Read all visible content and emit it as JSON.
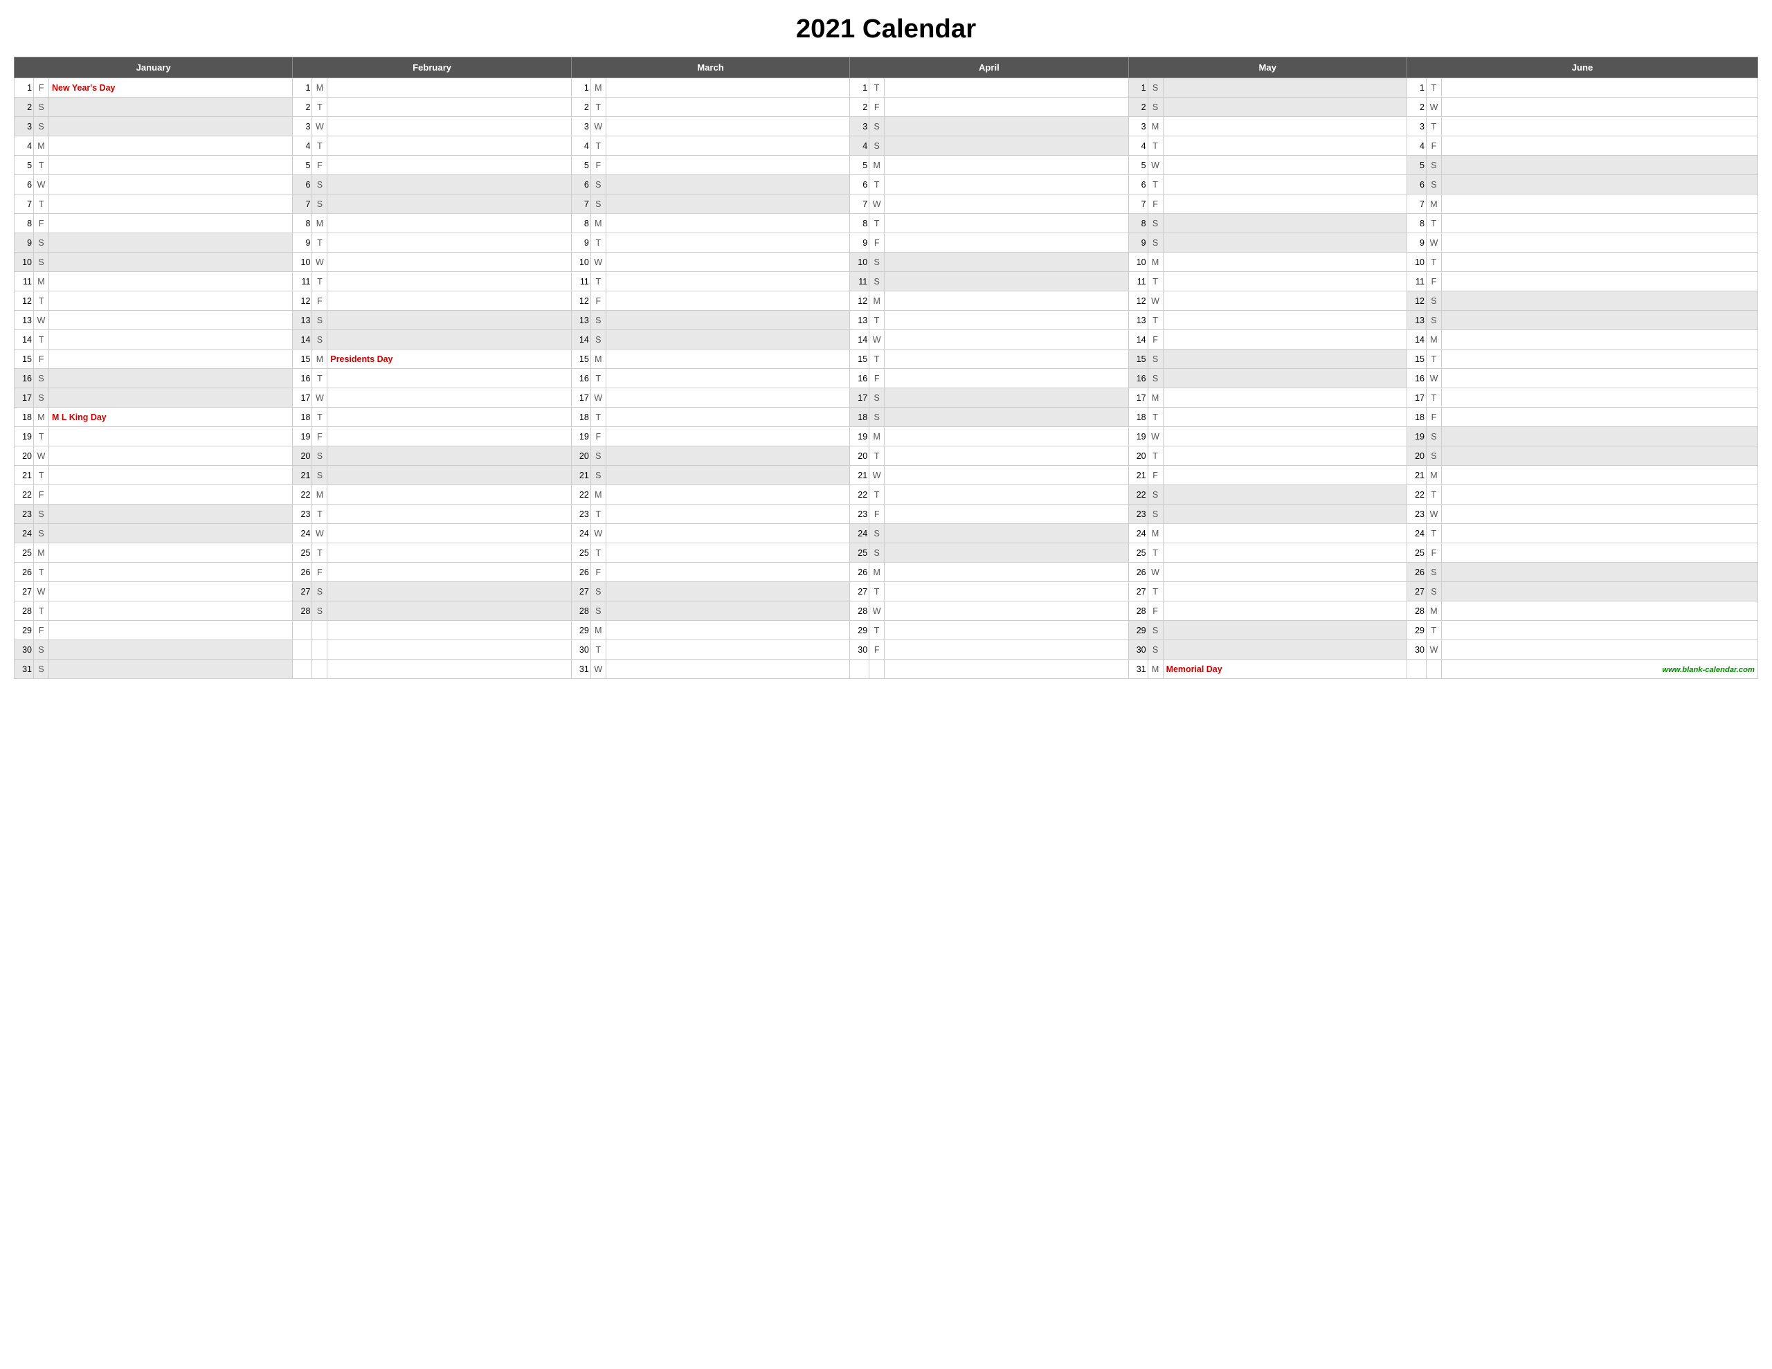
{
  "title": "2021 Calendar",
  "months": [
    "January",
    "February",
    "March",
    "April",
    "May",
    "June"
  ],
  "website": "www.blank-calendar.com",
  "days": {
    "jan": [
      {
        "d": 1,
        "l": "F",
        "holiday": "New Year's Day",
        "shade": false
      },
      {
        "d": 2,
        "l": "S",
        "holiday": "",
        "shade": true
      },
      {
        "d": 3,
        "l": "S",
        "holiday": "",
        "shade": true
      },
      {
        "d": 4,
        "l": "M",
        "holiday": "",
        "shade": false
      },
      {
        "d": 5,
        "l": "T",
        "holiday": "",
        "shade": false
      },
      {
        "d": 6,
        "l": "W",
        "holiday": "",
        "shade": false
      },
      {
        "d": 7,
        "l": "T",
        "holiday": "",
        "shade": false
      },
      {
        "d": 8,
        "l": "F",
        "holiday": "",
        "shade": false
      },
      {
        "d": 9,
        "l": "S",
        "holiday": "",
        "shade": true
      },
      {
        "d": 10,
        "l": "S",
        "holiday": "",
        "shade": true
      },
      {
        "d": 11,
        "l": "M",
        "holiday": "",
        "shade": false
      },
      {
        "d": 12,
        "l": "T",
        "holiday": "",
        "shade": false
      },
      {
        "d": 13,
        "l": "W",
        "holiday": "",
        "shade": false
      },
      {
        "d": 14,
        "l": "T",
        "holiday": "",
        "shade": false
      },
      {
        "d": 15,
        "l": "F",
        "holiday": "",
        "shade": false
      },
      {
        "d": 16,
        "l": "S",
        "holiday": "",
        "shade": true
      },
      {
        "d": 17,
        "l": "S",
        "holiday": "",
        "shade": true
      },
      {
        "d": 18,
        "l": "M",
        "holiday": "M L King Day",
        "shade": false
      },
      {
        "d": 19,
        "l": "T",
        "holiday": "",
        "shade": false
      },
      {
        "d": 20,
        "l": "W",
        "holiday": "",
        "shade": false
      },
      {
        "d": 21,
        "l": "T",
        "holiday": "",
        "shade": false
      },
      {
        "d": 22,
        "l": "F",
        "holiday": "",
        "shade": false
      },
      {
        "d": 23,
        "l": "S",
        "holiday": "",
        "shade": true
      },
      {
        "d": 24,
        "l": "S",
        "holiday": "",
        "shade": true
      },
      {
        "d": 25,
        "l": "M",
        "holiday": "",
        "shade": false
      },
      {
        "d": 26,
        "l": "T",
        "holiday": "",
        "shade": false
      },
      {
        "d": 27,
        "l": "W",
        "holiday": "",
        "shade": false
      },
      {
        "d": 28,
        "l": "T",
        "holiday": "",
        "shade": false
      },
      {
        "d": 29,
        "l": "F",
        "holiday": "",
        "shade": false
      },
      {
        "d": 30,
        "l": "S",
        "holiday": "",
        "shade": true
      },
      {
        "d": 31,
        "l": "S",
        "holiday": "",
        "shade": true
      }
    ],
    "feb": [
      {
        "d": 1,
        "l": "M",
        "holiday": "",
        "shade": false
      },
      {
        "d": 2,
        "l": "T",
        "holiday": "",
        "shade": false
      },
      {
        "d": 3,
        "l": "W",
        "holiday": "",
        "shade": false
      },
      {
        "d": 4,
        "l": "T",
        "holiday": "",
        "shade": false
      },
      {
        "d": 5,
        "l": "F",
        "holiday": "",
        "shade": false
      },
      {
        "d": 6,
        "l": "S",
        "holiday": "",
        "shade": true
      },
      {
        "d": 7,
        "l": "S",
        "holiday": "",
        "shade": true
      },
      {
        "d": 8,
        "l": "M",
        "holiday": "",
        "shade": false
      },
      {
        "d": 9,
        "l": "T",
        "holiday": "",
        "shade": false
      },
      {
        "d": 10,
        "l": "W",
        "holiday": "",
        "shade": false
      },
      {
        "d": 11,
        "l": "T",
        "holiday": "",
        "shade": false
      },
      {
        "d": 12,
        "l": "F",
        "holiday": "",
        "shade": false
      },
      {
        "d": 13,
        "l": "S",
        "holiday": "",
        "shade": true
      },
      {
        "d": 14,
        "l": "S",
        "holiday": "",
        "shade": true
      },
      {
        "d": 15,
        "l": "M",
        "holiday": "Presidents Day",
        "shade": false
      },
      {
        "d": 16,
        "l": "T",
        "holiday": "",
        "shade": false
      },
      {
        "d": 17,
        "l": "W",
        "holiday": "",
        "shade": false
      },
      {
        "d": 18,
        "l": "T",
        "holiday": "",
        "shade": false
      },
      {
        "d": 19,
        "l": "F",
        "holiday": "",
        "shade": false
      },
      {
        "d": 20,
        "l": "S",
        "holiday": "",
        "shade": true
      },
      {
        "d": 21,
        "l": "S",
        "holiday": "",
        "shade": true
      },
      {
        "d": 22,
        "l": "M",
        "holiday": "",
        "shade": false
      },
      {
        "d": 23,
        "l": "T",
        "holiday": "",
        "shade": false
      },
      {
        "d": 24,
        "l": "W",
        "holiday": "",
        "shade": false
      },
      {
        "d": 25,
        "l": "T",
        "holiday": "",
        "shade": false
      },
      {
        "d": 26,
        "l": "F",
        "holiday": "",
        "shade": false
      },
      {
        "d": 27,
        "l": "S",
        "holiday": "",
        "shade": true
      },
      {
        "d": 28,
        "l": "S",
        "holiday": "",
        "shade": true
      }
    ],
    "mar": [
      {
        "d": 1,
        "l": "M",
        "holiday": "",
        "shade": false
      },
      {
        "d": 2,
        "l": "T",
        "holiday": "",
        "shade": false
      },
      {
        "d": 3,
        "l": "W",
        "holiday": "",
        "shade": false
      },
      {
        "d": 4,
        "l": "T",
        "holiday": "",
        "shade": false
      },
      {
        "d": 5,
        "l": "F",
        "holiday": "",
        "shade": false
      },
      {
        "d": 6,
        "l": "S",
        "holiday": "",
        "shade": true
      },
      {
        "d": 7,
        "l": "S",
        "holiday": "",
        "shade": true
      },
      {
        "d": 8,
        "l": "M",
        "holiday": "",
        "shade": false
      },
      {
        "d": 9,
        "l": "T",
        "holiday": "",
        "shade": false
      },
      {
        "d": 10,
        "l": "W",
        "holiday": "",
        "shade": false
      },
      {
        "d": 11,
        "l": "T",
        "holiday": "",
        "shade": false
      },
      {
        "d": 12,
        "l": "F",
        "holiday": "",
        "shade": false
      },
      {
        "d": 13,
        "l": "S",
        "holiday": "",
        "shade": true
      },
      {
        "d": 14,
        "l": "S",
        "holiday": "",
        "shade": true
      },
      {
        "d": 15,
        "l": "M",
        "holiday": "",
        "shade": false
      },
      {
        "d": 16,
        "l": "T",
        "holiday": "",
        "shade": false
      },
      {
        "d": 17,
        "l": "W",
        "holiday": "",
        "shade": false
      },
      {
        "d": 18,
        "l": "T",
        "holiday": "",
        "shade": false
      },
      {
        "d": 19,
        "l": "F",
        "holiday": "",
        "shade": false
      },
      {
        "d": 20,
        "l": "S",
        "holiday": "",
        "shade": true
      },
      {
        "d": 21,
        "l": "S",
        "holiday": "",
        "shade": true
      },
      {
        "d": 22,
        "l": "M",
        "holiday": "",
        "shade": false
      },
      {
        "d": 23,
        "l": "T",
        "holiday": "",
        "shade": false
      },
      {
        "d": 24,
        "l": "W",
        "holiday": "",
        "shade": false
      },
      {
        "d": 25,
        "l": "T",
        "holiday": "",
        "shade": false
      },
      {
        "d": 26,
        "l": "F",
        "holiday": "",
        "shade": false
      },
      {
        "d": 27,
        "l": "S",
        "holiday": "",
        "shade": true
      },
      {
        "d": 28,
        "l": "S",
        "holiday": "",
        "shade": true
      },
      {
        "d": 29,
        "l": "M",
        "holiday": "",
        "shade": false
      },
      {
        "d": 30,
        "l": "T",
        "holiday": "",
        "shade": false
      },
      {
        "d": 31,
        "l": "W",
        "holiday": "",
        "shade": false
      }
    ],
    "apr": [
      {
        "d": 1,
        "l": "T",
        "holiday": "",
        "shade": false
      },
      {
        "d": 2,
        "l": "F",
        "holiday": "",
        "shade": false
      },
      {
        "d": 3,
        "l": "S",
        "holiday": "",
        "shade": true
      },
      {
        "d": 4,
        "l": "S",
        "holiday": "",
        "shade": true
      },
      {
        "d": 5,
        "l": "M",
        "holiday": "",
        "shade": false
      },
      {
        "d": 6,
        "l": "T",
        "holiday": "",
        "shade": false
      },
      {
        "d": 7,
        "l": "W",
        "holiday": "",
        "shade": false
      },
      {
        "d": 8,
        "l": "T",
        "holiday": "",
        "shade": false
      },
      {
        "d": 9,
        "l": "F",
        "holiday": "",
        "shade": false
      },
      {
        "d": 10,
        "l": "S",
        "holiday": "",
        "shade": true
      },
      {
        "d": 11,
        "l": "S",
        "holiday": "",
        "shade": true
      },
      {
        "d": 12,
        "l": "M",
        "holiday": "",
        "shade": false
      },
      {
        "d": 13,
        "l": "T",
        "holiday": "",
        "shade": false
      },
      {
        "d": 14,
        "l": "W",
        "holiday": "",
        "shade": false
      },
      {
        "d": 15,
        "l": "T",
        "holiday": "",
        "shade": false
      },
      {
        "d": 16,
        "l": "F",
        "holiday": "",
        "shade": false
      },
      {
        "d": 17,
        "l": "S",
        "holiday": "",
        "shade": true
      },
      {
        "d": 18,
        "l": "S",
        "holiday": "",
        "shade": true
      },
      {
        "d": 19,
        "l": "M",
        "holiday": "",
        "shade": false
      },
      {
        "d": 20,
        "l": "T",
        "holiday": "",
        "shade": false
      },
      {
        "d": 21,
        "l": "W",
        "holiday": "",
        "shade": false
      },
      {
        "d": 22,
        "l": "T",
        "holiday": "",
        "shade": false
      },
      {
        "d": 23,
        "l": "F",
        "holiday": "",
        "shade": false
      },
      {
        "d": 24,
        "l": "S",
        "holiday": "",
        "shade": true
      },
      {
        "d": 25,
        "l": "S",
        "holiday": "",
        "shade": true
      },
      {
        "d": 26,
        "l": "M",
        "holiday": "",
        "shade": false
      },
      {
        "d": 27,
        "l": "T",
        "holiday": "",
        "shade": false
      },
      {
        "d": 28,
        "l": "W",
        "holiday": "",
        "shade": false
      },
      {
        "d": 29,
        "l": "T",
        "holiday": "",
        "shade": false
      },
      {
        "d": 30,
        "l": "F",
        "holiday": "",
        "shade": false
      }
    ],
    "may": [
      {
        "d": 1,
        "l": "S",
        "holiday": "",
        "shade": true
      },
      {
        "d": 2,
        "l": "S",
        "holiday": "",
        "shade": true
      },
      {
        "d": 3,
        "l": "M",
        "holiday": "",
        "shade": false
      },
      {
        "d": 4,
        "l": "T",
        "holiday": "",
        "shade": false
      },
      {
        "d": 5,
        "l": "W",
        "holiday": "",
        "shade": false
      },
      {
        "d": 6,
        "l": "T",
        "holiday": "",
        "shade": false
      },
      {
        "d": 7,
        "l": "F",
        "holiday": "",
        "shade": false
      },
      {
        "d": 8,
        "l": "S",
        "holiday": "",
        "shade": true
      },
      {
        "d": 9,
        "l": "S",
        "holiday": "",
        "shade": true
      },
      {
        "d": 10,
        "l": "M",
        "holiday": "",
        "shade": false
      },
      {
        "d": 11,
        "l": "T",
        "holiday": "",
        "shade": false
      },
      {
        "d": 12,
        "l": "W",
        "holiday": "",
        "shade": false
      },
      {
        "d": 13,
        "l": "T",
        "holiday": "",
        "shade": false
      },
      {
        "d": 14,
        "l": "F",
        "holiday": "",
        "shade": false
      },
      {
        "d": 15,
        "l": "S",
        "holiday": "",
        "shade": true
      },
      {
        "d": 16,
        "l": "S",
        "holiday": "",
        "shade": true
      },
      {
        "d": 17,
        "l": "M",
        "holiday": "",
        "shade": false
      },
      {
        "d": 18,
        "l": "T",
        "holiday": "",
        "shade": false
      },
      {
        "d": 19,
        "l": "W",
        "holiday": "",
        "shade": false
      },
      {
        "d": 20,
        "l": "T",
        "holiday": "",
        "shade": false
      },
      {
        "d": 21,
        "l": "F",
        "holiday": "",
        "shade": false
      },
      {
        "d": 22,
        "l": "S",
        "holiday": "",
        "shade": true
      },
      {
        "d": 23,
        "l": "S",
        "holiday": "",
        "shade": true
      },
      {
        "d": 24,
        "l": "M",
        "holiday": "",
        "shade": false
      },
      {
        "d": 25,
        "l": "T",
        "holiday": "",
        "shade": false
      },
      {
        "d": 26,
        "l": "W",
        "holiday": "",
        "shade": false
      },
      {
        "d": 27,
        "l": "T",
        "holiday": "",
        "shade": false
      },
      {
        "d": 28,
        "l": "F",
        "holiday": "",
        "shade": false
      },
      {
        "d": 29,
        "l": "S",
        "holiday": "",
        "shade": true
      },
      {
        "d": 30,
        "l": "S",
        "holiday": "",
        "shade": true
      },
      {
        "d": 31,
        "l": "M",
        "holiday": "Memorial Day",
        "shade": false
      }
    ],
    "jun": [
      {
        "d": 1,
        "l": "T",
        "holiday": "",
        "shade": false
      },
      {
        "d": 2,
        "l": "W",
        "holiday": "",
        "shade": false
      },
      {
        "d": 3,
        "l": "T",
        "holiday": "",
        "shade": false
      },
      {
        "d": 4,
        "l": "F",
        "holiday": "",
        "shade": false
      },
      {
        "d": 5,
        "l": "S",
        "holiday": "",
        "shade": true
      },
      {
        "d": 6,
        "l": "S",
        "holiday": "",
        "shade": true
      },
      {
        "d": 7,
        "l": "M",
        "holiday": "",
        "shade": false
      },
      {
        "d": 8,
        "l": "T",
        "holiday": "",
        "shade": false
      },
      {
        "d": 9,
        "l": "W",
        "holiday": "",
        "shade": false
      },
      {
        "d": 10,
        "l": "T",
        "holiday": "",
        "shade": false
      },
      {
        "d": 11,
        "l": "F",
        "holiday": "",
        "shade": false
      },
      {
        "d": 12,
        "l": "S",
        "holiday": "",
        "shade": true
      },
      {
        "d": 13,
        "l": "S",
        "holiday": "",
        "shade": true
      },
      {
        "d": 14,
        "l": "M",
        "holiday": "",
        "shade": false
      },
      {
        "d": 15,
        "l": "T",
        "holiday": "",
        "shade": false
      },
      {
        "d": 16,
        "l": "W",
        "holiday": "",
        "shade": false
      },
      {
        "d": 17,
        "l": "T",
        "holiday": "",
        "shade": false
      },
      {
        "d": 18,
        "l": "F",
        "holiday": "",
        "shade": false
      },
      {
        "d": 19,
        "l": "S",
        "holiday": "",
        "shade": true
      },
      {
        "d": 20,
        "l": "S",
        "holiday": "",
        "shade": true
      },
      {
        "d": 21,
        "l": "M",
        "holiday": "",
        "shade": false
      },
      {
        "d": 22,
        "l": "T",
        "holiday": "",
        "shade": false
      },
      {
        "d": 23,
        "l": "W",
        "holiday": "",
        "shade": false
      },
      {
        "d": 24,
        "l": "T",
        "holiday": "",
        "shade": false
      },
      {
        "d": 25,
        "l": "F",
        "holiday": "",
        "shade": false
      },
      {
        "d": 26,
        "l": "S",
        "holiday": "",
        "shade": true
      },
      {
        "d": 27,
        "l": "S",
        "holiday": "",
        "shade": true
      },
      {
        "d": 28,
        "l": "M",
        "holiday": "",
        "shade": false
      },
      {
        "d": 29,
        "l": "T",
        "holiday": "",
        "shade": false
      },
      {
        "d": 30,
        "l": "W",
        "holiday": "",
        "shade": false
      }
    ]
  }
}
